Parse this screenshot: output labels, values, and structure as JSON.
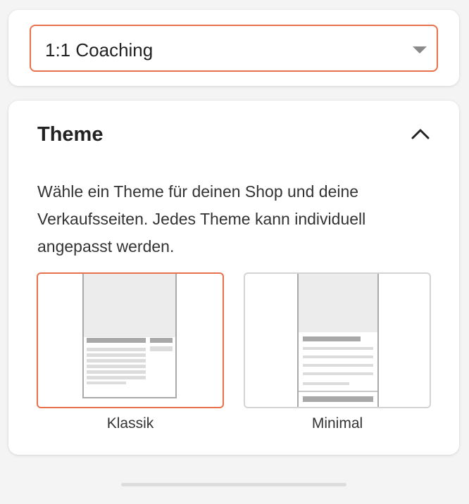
{
  "product_select": {
    "value": "1:1 Coaching",
    "caret_icon": "caret-down-icon"
  },
  "theme_section": {
    "title": "Theme",
    "collapse_icon": "chevron-up-icon",
    "description": "Wähle ein Theme für deinen Shop und deine Verkaufsseiten. Jedes Theme kann individuell angepasst werden.",
    "options": [
      {
        "label": "Klassik",
        "selected": true
      },
      {
        "label": "Minimal",
        "selected": false
      }
    ]
  },
  "colors": {
    "accent": "#e8714b",
    "background": "#f4f4f4",
    "card": "#ffffff"
  }
}
